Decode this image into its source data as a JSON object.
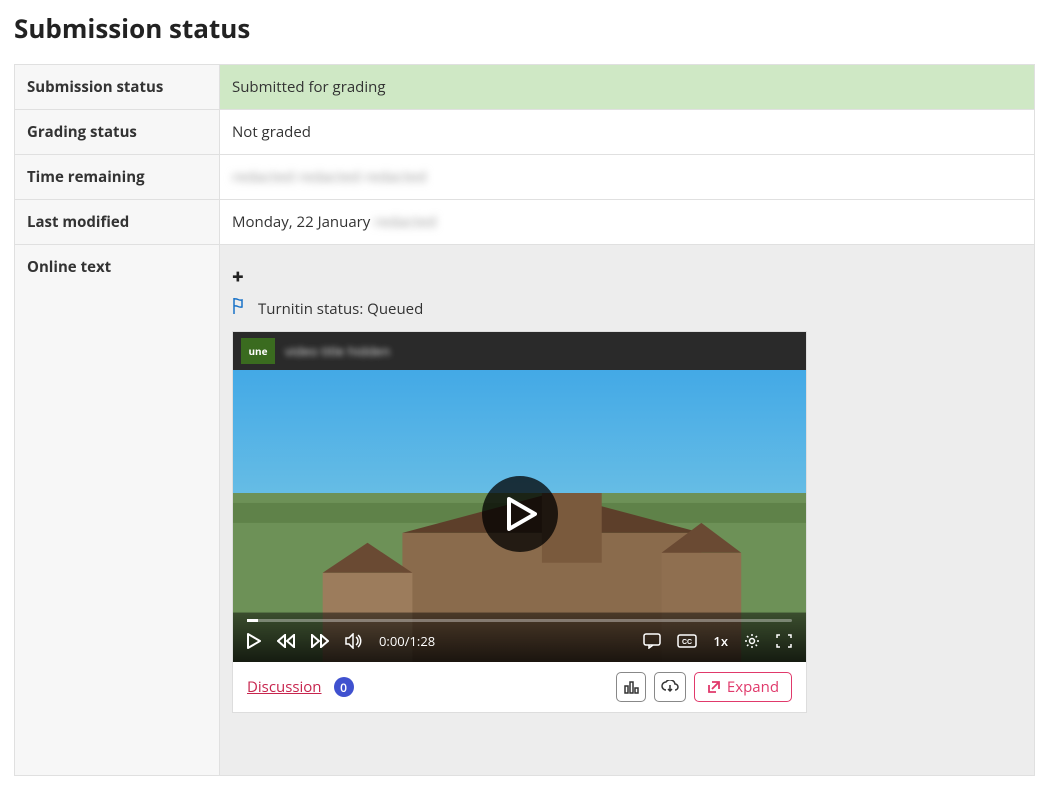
{
  "page": {
    "title": "Submission status"
  },
  "rows": {
    "submission_status": {
      "label": "Submission status",
      "value": "Submitted for grading"
    },
    "grading_status": {
      "label": "Grading status",
      "value": "Not graded"
    },
    "time_remaining": {
      "label": "Time remaining",
      "value": "redacted redacted redacted"
    },
    "last_modified": {
      "label": "Last modified",
      "value_prefix": "Monday, 22 January",
      "value_suffix_blurred": "redacted"
    },
    "online_text": {
      "label": "Online text"
    }
  },
  "online": {
    "expand_toggle_glyph": "+",
    "turnitin_status": "Turnitin status: Queued"
  },
  "player": {
    "logo_text": "une",
    "title_blurred": "video title hidden",
    "time_display": "0:00/1:28",
    "speed_label": "1x",
    "discussion_label": "Discussion",
    "discussion_count": "0",
    "expand_label": "Expand"
  }
}
